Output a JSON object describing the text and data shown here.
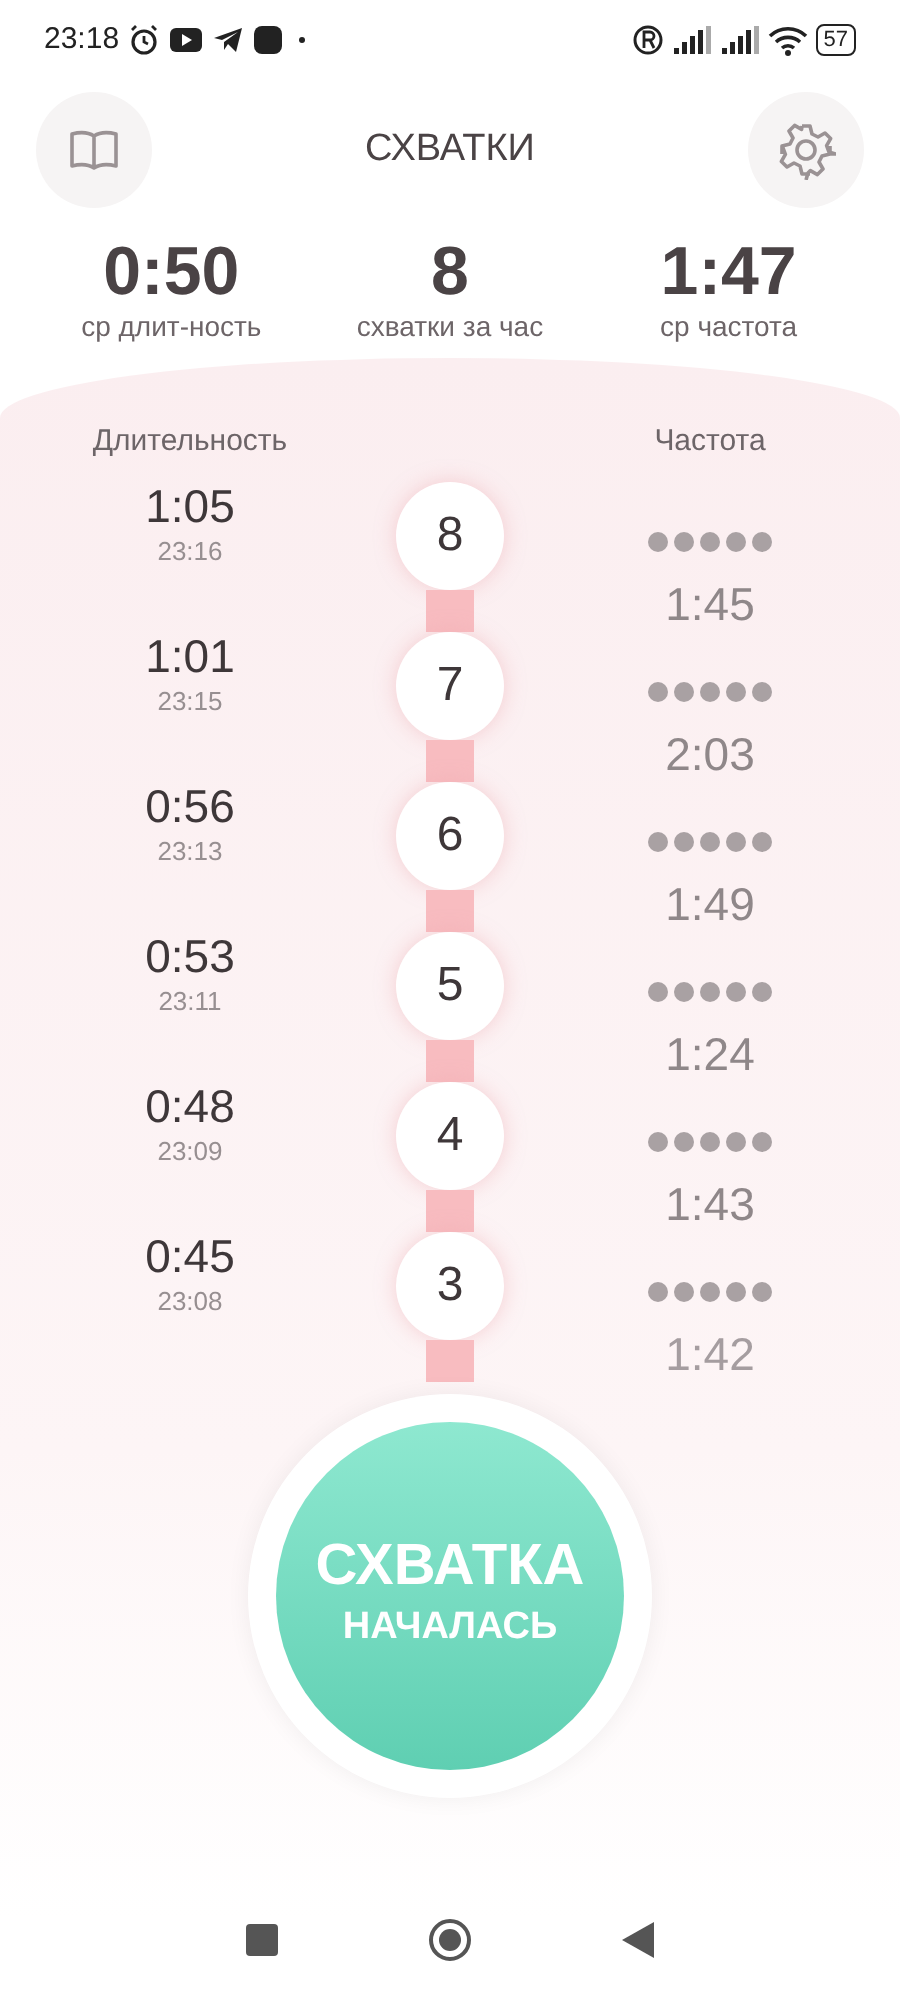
{
  "status_bar": {
    "time": "23:18",
    "battery": "57"
  },
  "header": {
    "title": "СХВАТКИ"
  },
  "stats": [
    {
      "value": "0:50",
      "label": "ср длит-ность"
    },
    {
      "value": "8",
      "label": "схватки за час"
    },
    {
      "value": "1:47",
      "label": "ср частота"
    }
  ],
  "columns": {
    "duration": "Длительность",
    "frequency": "Частота"
  },
  "contractions": [
    {
      "number": "8",
      "duration": "1:05",
      "time": "23:16",
      "interval": "1:45"
    },
    {
      "number": "7",
      "duration": "1:01",
      "time": "23:15",
      "interval": "2:03"
    },
    {
      "number": "6",
      "duration": "0:56",
      "time": "23:13",
      "interval": "1:49"
    },
    {
      "number": "5",
      "duration": "0:53",
      "time": "23:11",
      "interval": "1:24"
    },
    {
      "number": "4",
      "duration": "0:48",
      "time": "23:09",
      "interval": "1:43"
    },
    {
      "number": "3",
      "duration": "0:45",
      "time": "23:08",
      "interval": "1:42"
    }
  ],
  "start_button": {
    "line_1": "СХВАТКА",
    "line_2": "НАЧАЛАСЬ"
  }
}
